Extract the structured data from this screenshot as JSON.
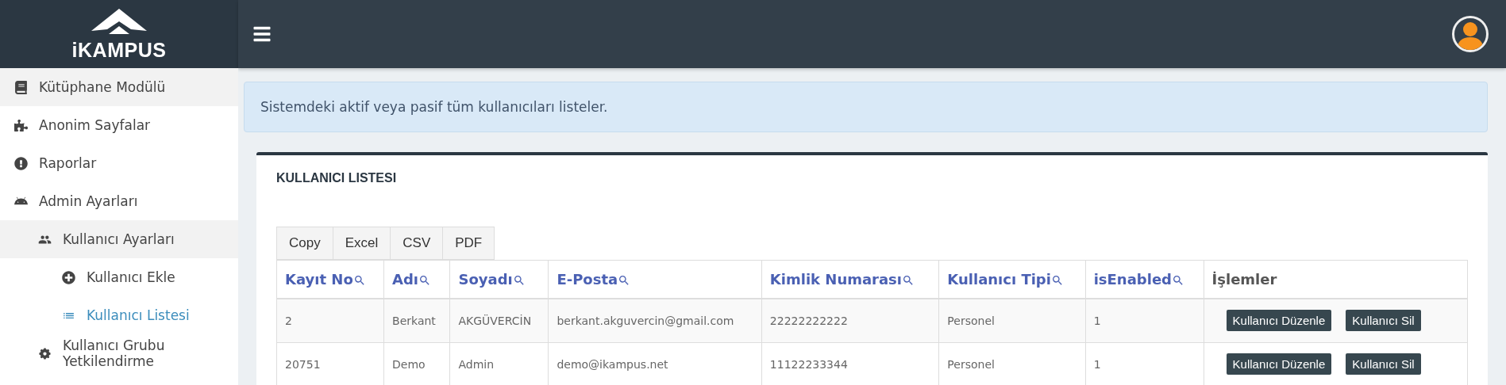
{
  "logo": {
    "text": "iKAMPUS"
  },
  "sidebar": {
    "items": [
      {
        "label": "Kütüphane Modülü",
        "kind": "book",
        "highlighted": true,
        "selected": false
      },
      {
        "label": "Anonim Sayfalar",
        "kind": "puzzle",
        "highlighted": false,
        "selected": false
      },
      {
        "label": "Raporlar",
        "kind": "alert",
        "highlighted": false,
        "selected": false
      },
      {
        "label": "Admin Ayarları",
        "kind": "android",
        "highlighted": false,
        "selected": false,
        "children": [
          {
            "label": "Kullanıcı Ayarları",
            "kind": "users",
            "highlighted": true,
            "selected": false,
            "children": [
              {
                "label": "Kullanıcı Ekle",
                "kind": "plus",
                "highlighted": false,
                "selected": false
              },
              {
                "label": "Kullanıcı Listesi",
                "kind": "list",
                "highlighted": false,
                "selected": true
              }
            ]
          },
          {
            "label": "Kullanıcı Grubu Yetkilendirme",
            "kind": "gear",
            "highlighted": false,
            "selected": false
          }
        ]
      }
    ]
  },
  "alert": {
    "text": "Sistemdeki aktif veya pasif tüm kullanıcıları listeler."
  },
  "card": {
    "title": "KULLANICI LISTESI",
    "export_buttons": [
      "Copy",
      "Excel",
      "CSV",
      "PDF"
    ],
    "table": {
      "columns": [
        {
          "label": "Kayıt No",
          "searchable": true
        },
        {
          "label": "Adı",
          "searchable": true
        },
        {
          "label": "Soyadı",
          "searchable": true
        },
        {
          "label": "E-Posta",
          "searchable": true
        },
        {
          "label": "Kimlik Numarası",
          "searchable": true
        },
        {
          "label": "Kullanıcı Tipi",
          "searchable": true
        },
        {
          "label": "isEnabled",
          "searchable": true
        },
        {
          "label": "İşlemler",
          "searchable": false
        }
      ],
      "rows": [
        {
          "cells": [
            "2",
            "Berkant",
            "AKGÜVERCİN",
            "berkant.akguvercin@gmail.com",
            "22222222222",
            "Personel",
            "1"
          ],
          "actions": [
            "Kullanıcı Düzenle",
            "Kullanıcı Sil"
          ]
        },
        {
          "cells": [
            "20751",
            "Demo",
            "Admin",
            "demo@ikampus.net",
            "11122233344",
            "Personel",
            "1"
          ],
          "actions": [
            "Kullanıcı Düzenle",
            "Kullanıcı Sil"
          ]
        }
      ]
    }
  }
}
